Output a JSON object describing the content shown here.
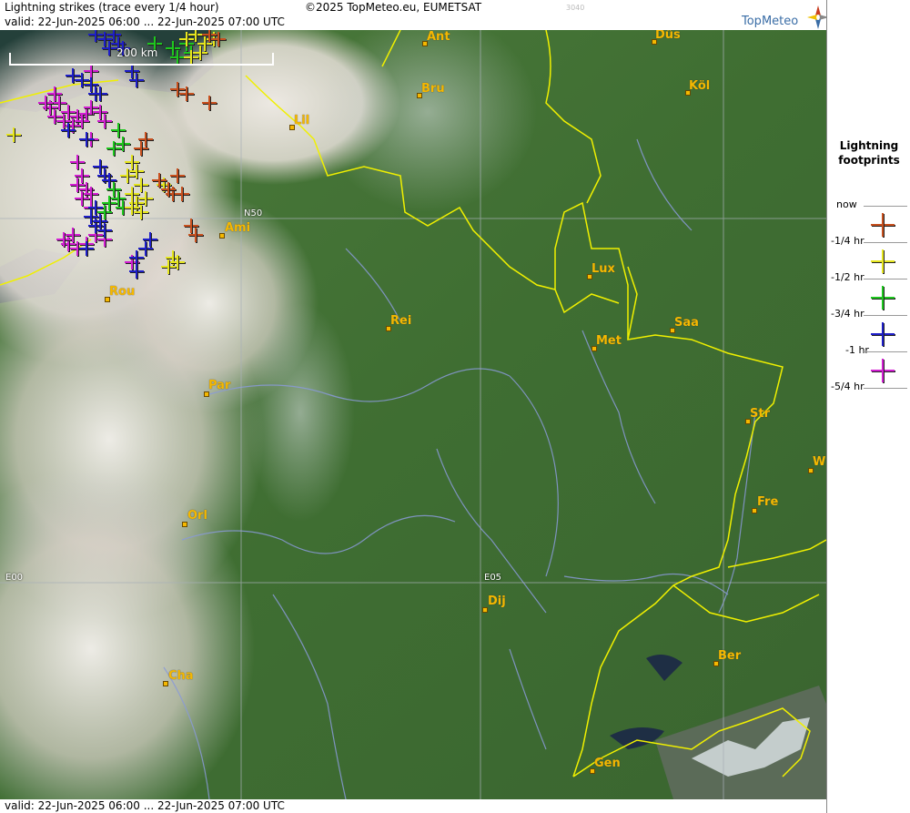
{
  "header": {
    "title": "Lightning strikes (trace every 1/4 hour)",
    "copyright": "©2025 TopMeteo.eu, EUMETSAT",
    "code": "3040",
    "valid": "valid:  22-Jun-2025 06:00 ... 22-Jun-2025 07:00 UTC",
    "logo": "TopMeteo"
  },
  "footer": {
    "valid": "valid:  22-Jun-2025 06:00 ... 22-Jun-2025 07:00 UTC"
  },
  "scale": {
    "label": "200 km"
  },
  "grid_labels": {
    "n50": "N50",
    "e00": "E00",
    "e05": "E05"
  },
  "cities": [
    {
      "name": "Ant"
    },
    {
      "name": "Düs"
    },
    {
      "name": "Bru"
    },
    {
      "name": "Köl"
    },
    {
      "name": "Lil"
    },
    {
      "name": "Ami"
    },
    {
      "name": "Lux"
    },
    {
      "name": "Rei"
    },
    {
      "name": "Rou"
    },
    {
      "name": "Saa"
    },
    {
      "name": "Met"
    },
    {
      "name": "Par"
    },
    {
      "name": "Str"
    },
    {
      "name": "W"
    },
    {
      "name": "Fre"
    },
    {
      "name": "Orl"
    },
    {
      "name": "Dij"
    },
    {
      "name": "Ber"
    },
    {
      "name": "Cha"
    },
    {
      "name": "Gen"
    }
  ],
  "legend": {
    "title_1": "Lightning",
    "title_2": "footprints",
    "items": [
      {
        "label": "now",
        "color": ""
      },
      {
        "label": "-1/4 hr",
        "color": "#c8501e"
      },
      {
        "label": "-1/2 hr",
        "color": "#e6e61e"
      },
      {
        "label": "-3/4 hr",
        "color": "#1ec81e"
      },
      {
        "label": "-1 hr",
        "color": "#1e1ec8"
      },
      {
        "label": "-5/4 hr",
        "color": "#d21ed2"
      }
    ]
  },
  "strike_colors": {
    "q1": "#c8501e",
    "q2": "#e6e61e",
    "q3": "#1ec81e",
    "q4": "#1e1ec8",
    "q5": "#d21ed2"
  }
}
